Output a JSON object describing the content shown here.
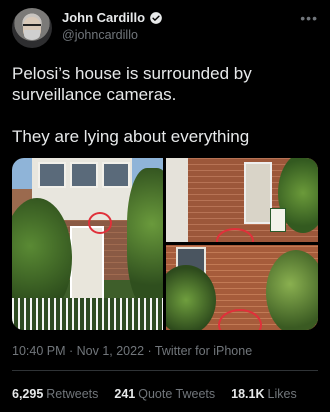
{
  "author": {
    "display_name": "John Cardillo",
    "handle": "@johncardillo",
    "verified": true
  },
  "tweet": {
    "line1": "Pelosi’s house is surrounded by surveillance cameras.",
    "line2": "They are lying about everything"
  },
  "media": {
    "images": [
      {
        "name": "house-front"
      },
      {
        "name": "brick-wall-sign"
      },
      {
        "name": "brick-wall-window"
      }
    ]
  },
  "meta": {
    "timestamp": "10:40 PM · Nov 1, 2022 · Twitter for iPhone"
  },
  "stats": {
    "retweets_count": "6,295",
    "retweets_label": "Retweets",
    "quotes_count": "241",
    "quotes_label": "Quote Tweets",
    "likes_count": "18.1K",
    "likes_label": "Likes"
  },
  "colors": {
    "background": "#000000",
    "text": "#e7e9ea",
    "secondary": "#71767b",
    "annotation_circle": "#e0303a"
  }
}
